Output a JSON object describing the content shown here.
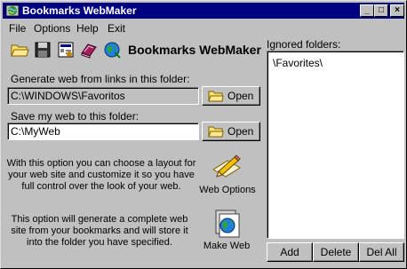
{
  "window": {
    "title": "Bookmarks WebMaker",
    "controls": {
      "minimize": "_",
      "maximize": "□",
      "close": "×"
    }
  },
  "menu": [
    "File",
    "Options",
    "Help",
    "Exit"
  ],
  "toolbar": {
    "icons": [
      "open-folder-icon",
      "save-disk-icon",
      "settings-icon",
      "books-icon",
      "globe-icon"
    ],
    "brand": "Bookmarks WebMaker"
  },
  "source": {
    "label": "Generate web from links in this folder:",
    "value": "C:\\WINDOWS\\Favoritos",
    "open_label": "Open"
  },
  "target": {
    "label": "Save my web to this folder:",
    "value": "C:\\MyWeb",
    "open_label": "Open"
  },
  "web_options": {
    "description": "With this option you can choose a layout for your web site and customize it so you have full control over the look of your web.",
    "label": "Web Options"
  },
  "make_web": {
    "description": "This option will generate a complete web site from your bookmarks and will store it into the folder you have specified.",
    "label": "Make Web"
  },
  "ignored": {
    "label": "Ignored folders:",
    "items": [
      "\\Favorites\\"
    ],
    "add_label": "Add",
    "delete_label": "Delete",
    "delall_label": "Del All"
  },
  "colors": {
    "titlebar": "#000080",
    "face": "#c0c0c0"
  }
}
